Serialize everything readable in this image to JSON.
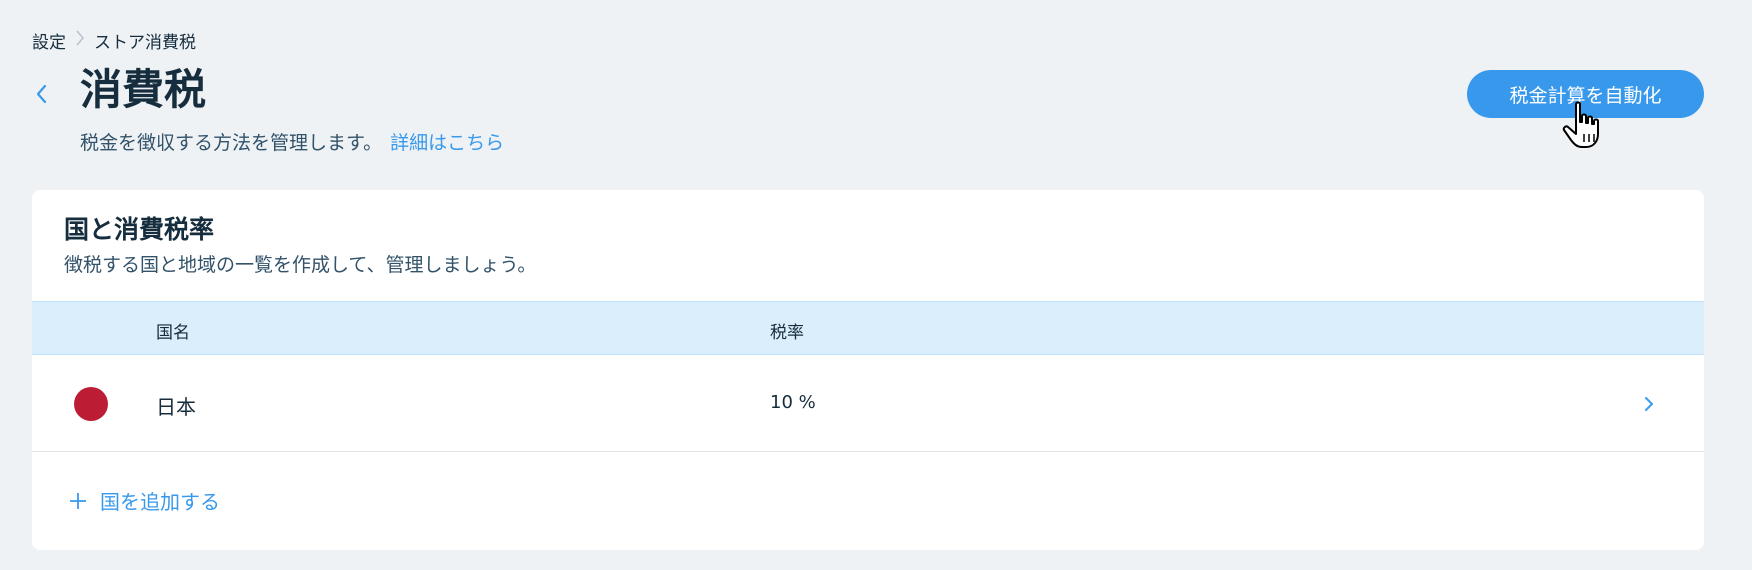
{
  "breadcrumb": {
    "items": [
      "設定",
      "ストア消費税"
    ],
    "separator": "〉"
  },
  "header": {
    "title": "消費税",
    "subtitle": "税金を徴収する方法を管理します。",
    "learn_more": "詳細はこちら",
    "automate_button": "税金計算を自動化"
  },
  "card": {
    "title": "国と消費税率",
    "subtitle": "徴税する国と地域の一覧を作成して、管理しましょう。",
    "columns": {
      "country": "国名",
      "rate": "税率"
    },
    "rows": [
      {
        "country": "日本",
        "rate": "10 %",
        "flag_color": "#bc1c34"
      }
    ],
    "add_country": "国を追加する"
  },
  "colors": {
    "accent": "#3899ec",
    "background": "#eff2f5",
    "table_header": "#daeefc",
    "text_primary": "#162d3d"
  },
  "icons": {
    "back": "chevron-left-icon",
    "row": "chevron-right-icon",
    "add": "plus-icon",
    "cursor": "hand-pointer-icon"
  }
}
